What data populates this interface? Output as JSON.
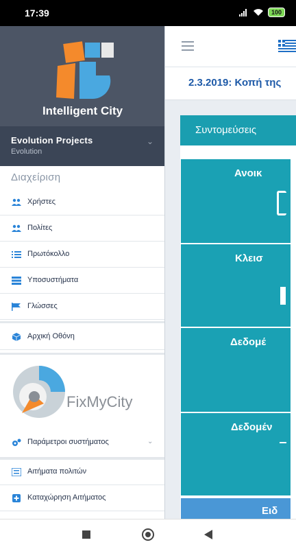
{
  "status_bar": {
    "time": "17:39",
    "battery": "100"
  },
  "sidebar": {
    "brand_name": "Intelligent City",
    "project": {
      "title": "Evolution Projects",
      "subtitle": "Evolution"
    },
    "section_title": "Διαχείριση",
    "admin_items": [
      {
        "label": "Χρήστες",
        "icon": "users-icon"
      },
      {
        "label": "Πολίτες",
        "icon": "citizens-icon"
      },
      {
        "label": "Πρωτόκολλο",
        "icon": "list-icon"
      },
      {
        "label": "Υποσυστήματα",
        "icon": "subsystems-icon"
      },
      {
        "label": "Γλώσσες",
        "icon": "flag-icon"
      }
    ],
    "home_item": {
      "label": "Αρχική Οθόνη",
      "icon": "cube-icon"
    },
    "fixmycity_label": "FixMyCity",
    "fix_items": [
      {
        "label": "Παράμετροι συστήματος",
        "icon": "gears-icon"
      },
      {
        "label": "Αιτήματα πολιτών",
        "icon": "requests-icon"
      },
      {
        "label": "Καταχώρηση Αιτήματος",
        "icon": "add-icon"
      }
    ]
  },
  "main": {
    "news_text": "2.3.2019: Κοπή της",
    "shortcuts_title": "Συντομεύσεις",
    "tiles": [
      {
        "label": "Ανοικ",
        "color": "#1aa1b4"
      },
      {
        "label": "Κλεισ",
        "color": "#1aa1b4"
      },
      {
        "label": "Δεδομέ",
        "color": "#1aa1b4"
      },
      {
        "label": "Δεδομέν",
        "color": "#1aa1b4"
      },
      {
        "label": "Ειδ",
        "color": "#4a97d6"
      }
    ]
  }
}
